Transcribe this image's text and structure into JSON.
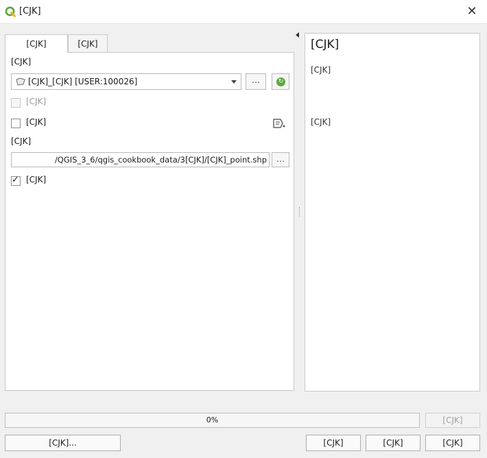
{
  "window": {
    "title": "중심점",
    "title_ascii": "[CJK]",
    "close_glyph": "✕"
  },
  "tabs": [
    {
      "label": "파라미터",
      "label_ascii": "[CJK]",
      "active": true
    },
    {
      "label": "로그",
      "label_ascii": "[CJK]",
      "active": false
    }
  ],
  "params": {
    "input_layer_label": "입력 레이어",
    "input_layer_label_ascii": "[CJK]",
    "input_layer_value": "구미동_공시지가도 [USER:100026]",
    "input_layer_value_ascii": "[CJK]_[CJK] [USER:100026]",
    "ellipsis": "…",
    "iterate_glyph": "↻",
    "selected_only_label": "선택한 객체만",
    "selected_only_label_ascii": "[CJK]",
    "selected_only_checked": false,
    "each_part_label": "각 부분의 표면에 포인트 생성",
    "each_part_label_ascii": "[CJK]",
    "each_part_checked": false,
    "output_label": "중심점",
    "output_label_ascii": "[CJK]",
    "output_path": "/QGIS_3_6/qgis_cookbook_data/3장/공시지가_point.shp",
    "output_path_ascii": "/QGIS_3_6/qgis_cookbook_data/3[CJK]/[CJK]_point.shp",
    "open_output_label": "알고리즘 실행 후 출력 파일 열기",
    "open_output_label_ascii": "[CJK]",
    "open_output_checked": true,
    "check_glyph": "✓"
  },
  "help": {
    "title": "중심점",
    "title_ascii": "[CJK]",
    "paragraph1": "이 알고리즘은 입력 레이어에 있는 도형들의 중심을 표현하는 포인트를 을 가진 새 포인트 레이어를 생성합니다.",
    "paragraph1_ascii": "[CJK]",
    "paragraph2": "출력 레이어에 있는 각 포인트에 관련된 속성은 원본 객체 관련 속성과 동일합니다.",
    "paragraph2_ascii": "[CJK]"
  },
  "progress": {
    "value": 0,
    "label": "0%"
  },
  "buttons": {
    "cancel": "취소",
    "cancel_ascii": "[CJK]",
    "batch": "배치 프로세스로 실행...",
    "batch_ascii": "[CJK]...",
    "run": "실행",
    "run_ascii": "[CJK]",
    "close": "닫기",
    "close_ascii": "[CJK]",
    "help": "도움말",
    "help_ascii": "[CJK]"
  },
  "colors": {
    "qgis_icon": "#5aa33c",
    "background": "#f0f0f0"
  }
}
